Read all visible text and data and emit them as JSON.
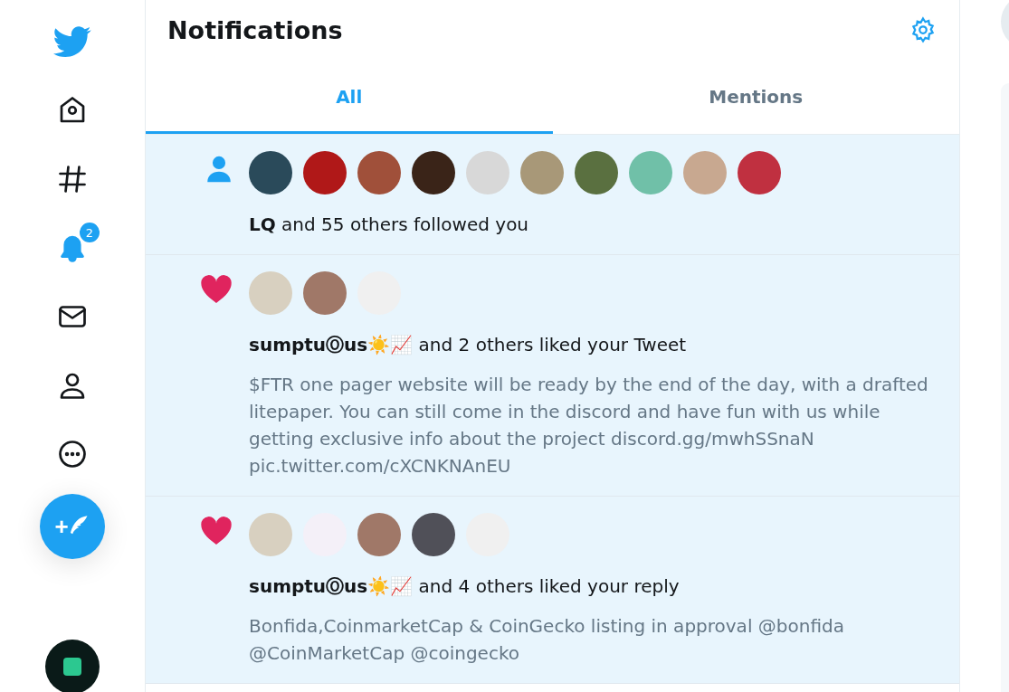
{
  "nav": [
    {
      "kind": "logo"
    },
    {
      "kind": "home",
      "selected": false
    },
    {
      "kind": "explore",
      "selected": false
    },
    {
      "kind": "notifications",
      "selected": true,
      "badge": "2"
    },
    {
      "kind": "messages",
      "selected": false
    },
    {
      "kind": "profile",
      "selected": false
    },
    {
      "kind": "more",
      "selected": false
    }
  ],
  "compose": {
    "label": "+"
  },
  "header": {
    "title": "Notifications"
  },
  "tabs": [
    {
      "label": "All",
      "selected": true
    },
    {
      "label": "Mentions",
      "selected": false
    }
  ],
  "notifications": [
    {
      "kind": "follow",
      "avatars": [
        {
          "color": "#2a4a5a"
        },
        {
          "color": "#b01818"
        },
        {
          "color": "#a0503a"
        },
        {
          "color": "#3a2418"
        },
        {
          "color": "#d8d8d8"
        },
        {
          "color": "#a89878"
        },
        {
          "color": "#5a7040"
        },
        {
          "color": "#70c0a8"
        },
        {
          "color": "#c8a890"
        },
        {
          "color": "#c03040"
        }
      ],
      "text": "**LQ** and 55 others followed you"
    },
    {
      "kind": "like",
      "avatars": [
        {
          "color": "#d8d0c0"
        },
        {
          "color": "#a07868"
        },
        {
          "color": "#f0f0f0"
        }
      ],
      "text": "**sumptuⓄus☀️📈** and 2 others liked your Tweet",
      "body": "$FTR one pager website will be ready by the end of the day, with a drafted litepaper. You can still come in the discord and have fun with us while getting exclusive info about the project discord.gg/mwhSSnaN pic.twitter.com/cXCNKNAnEU"
    },
    {
      "kind": "like",
      "avatars": [
        {
          "color": "#d8d0c0"
        },
        {
          "color": "#f4f0f8"
        },
        {
          "color": "#a07868"
        },
        {
          "color": "#505058"
        },
        {
          "color": "#f0f0f0"
        }
      ],
      "text": "**sumptuⓄus☀️📈** and 4 others liked your reply",
      "body": "Bonfida,CoinmarketCap & CoinGecko listing in approval @bonfida @CoinMarketCap @coingecko"
    }
  ]
}
